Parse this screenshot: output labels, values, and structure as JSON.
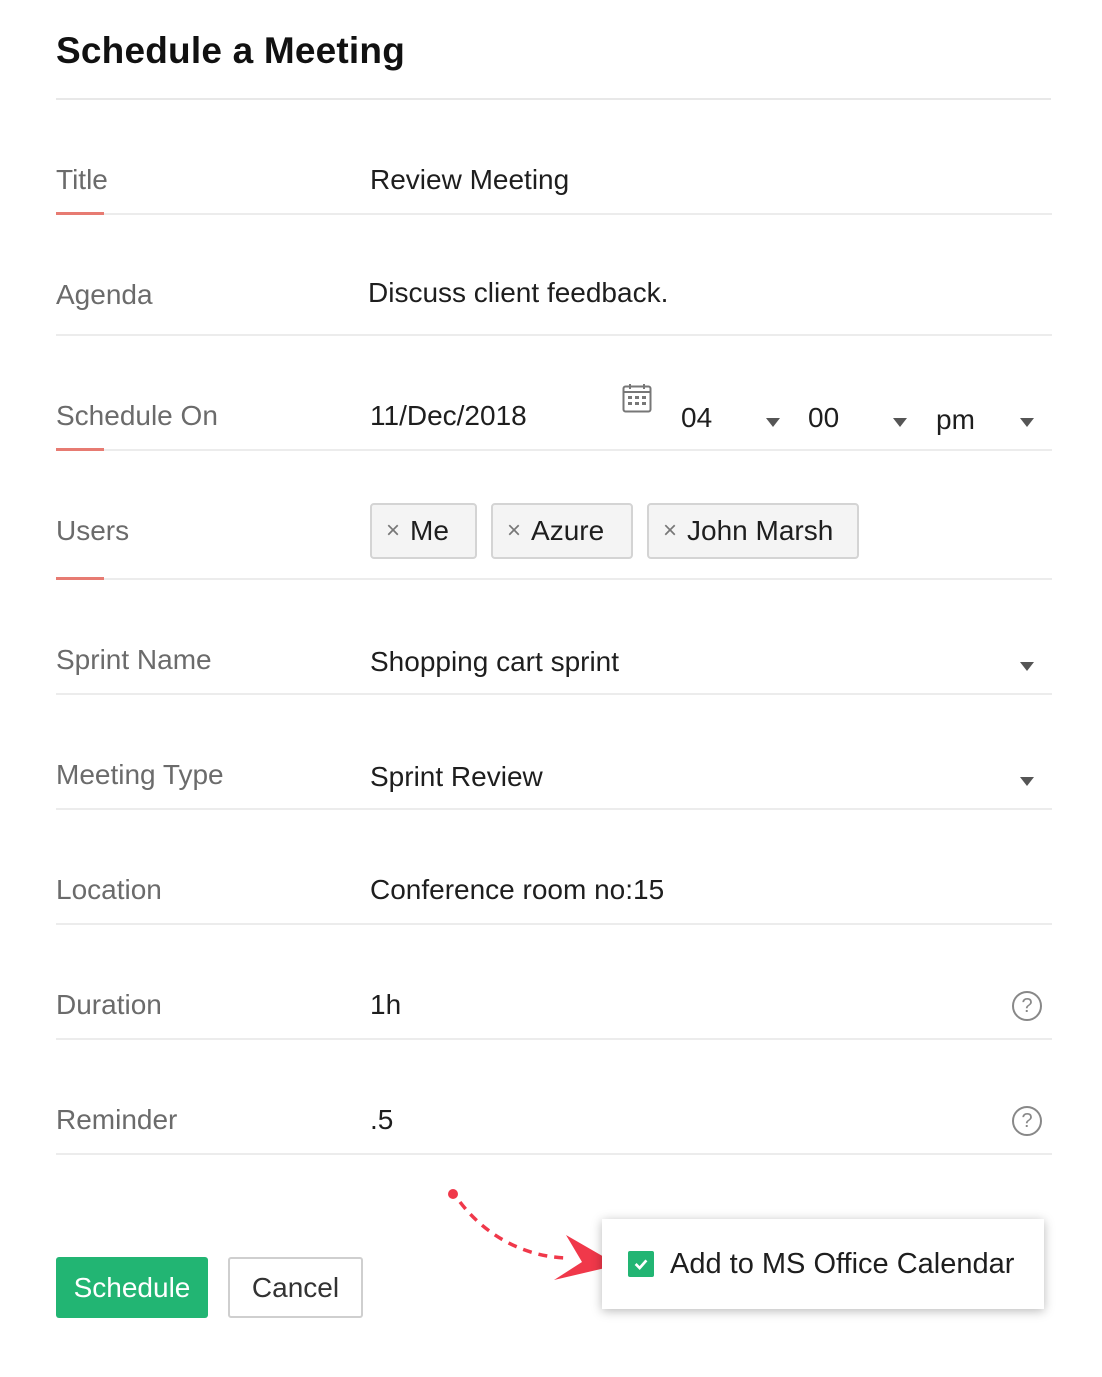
{
  "page": {
    "title": "Schedule a Meeting"
  },
  "fields": {
    "title": {
      "label": "Title",
      "value": "Review Meeting"
    },
    "agenda": {
      "label": "Agenda",
      "value": "Discuss client feedback."
    },
    "schedule_on": {
      "label": "Schedule On",
      "date": "11/Dec/2018",
      "hour": "04",
      "minute": "00",
      "meridiem": "pm",
      "calendar_icon": "calendar-icon"
    },
    "users": {
      "label": "Users",
      "chips": [
        "Me",
        "Azure",
        "John Marsh"
      ],
      "remove_glyph": "×"
    },
    "sprint_name": {
      "label": "Sprint Name",
      "value": "Shopping cart sprint"
    },
    "meeting_type": {
      "label": "Meeting Type",
      "value": "Sprint Review"
    },
    "location": {
      "label": "Location",
      "value": "Conference room no:15"
    },
    "duration": {
      "label": "Duration",
      "value": "1h",
      "help_glyph": "?"
    },
    "reminder": {
      "label": "Reminder",
      "value": ".5",
      "help_glyph": "?"
    }
  },
  "actions": {
    "schedule_label": "Schedule",
    "cancel_label": "Cancel"
  },
  "calendar_option": {
    "label": "Add to MS Office Calendar",
    "checked": true
  },
  "colors": {
    "accent": "#22b573",
    "required_marker": "#e77b72",
    "annotation_arrow": "#f0384a"
  }
}
